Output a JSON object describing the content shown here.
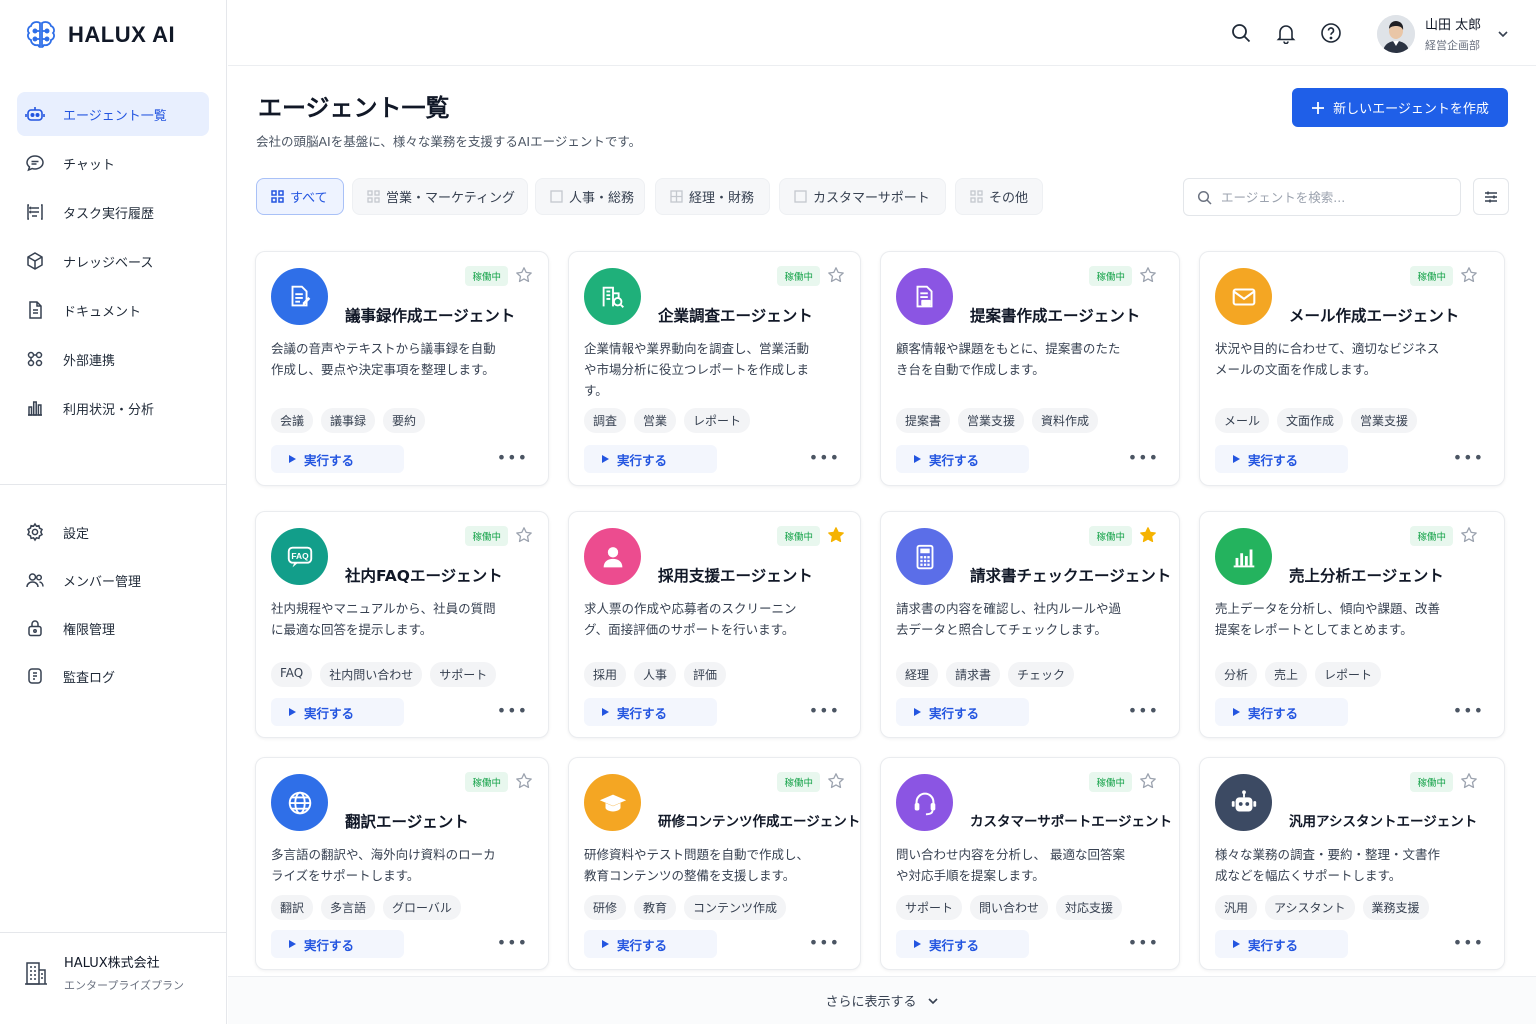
{
  "app": {
    "name": "HALUX AI"
  },
  "sidebar": {
    "items": [
      {
        "label": "エージェント一覧",
        "icon": "robot-icon",
        "active": true
      },
      {
        "label": "チャット",
        "icon": "chat-icon"
      },
      {
        "label": "タスク実行履歴",
        "icon": "task-history-icon"
      },
      {
        "label": "ナレッジベース",
        "icon": "cube-icon"
      },
      {
        "label": "ドキュメント",
        "icon": "document-icon"
      },
      {
        "label": "外部連携",
        "icon": "integration-icon"
      },
      {
        "label": "利用状況・分析",
        "icon": "analytics-icon"
      }
    ],
    "admin_items": [
      {
        "label": "設定",
        "icon": "gear-icon"
      },
      {
        "label": "メンバー管理",
        "icon": "users-icon"
      },
      {
        "label": "権限管理",
        "icon": "lock-icon"
      },
      {
        "label": "監査ログ",
        "icon": "audit-log-icon"
      }
    ],
    "org": {
      "name": "HALUX株式会社",
      "plan": "エンタープライズプラン"
    }
  },
  "header": {
    "user": {
      "name": "山田 太郎",
      "department": "経営企画部"
    }
  },
  "main": {
    "title": "エージェント一覧",
    "subtitle": "会社の頭脳AIを基盤に、様々な業務を支援するAIエージェントです。",
    "new_button": "新しいエージェントを作成",
    "tabs": [
      {
        "label": "すべて",
        "active": true
      },
      {
        "label": "営業・マーケティング"
      },
      {
        "label": "人事・総務"
      },
      {
        "label": "経理・財務"
      },
      {
        "label": "カスタマーサポート"
      },
      {
        "label": "その他"
      }
    ],
    "search_placeholder": "エージェントを検索...",
    "run_label": "実行する",
    "more_label": "•••",
    "show_more": "さらに表示する"
  },
  "agents": [
    {
      "title": "議事録作成エージェント",
      "status": "稼働中",
      "favorite": false,
      "icon": "minutes-doc-icon",
      "color": "#2f6fe8",
      "desc": "会議の音声やテキストから議事録を自動作成し、要点や決定事項を整理します。",
      "tags": [
        "会議",
        "議事録",
        "要約"
      ]
    },
    {
      "title": "企業調査エージェント",
      "status": "稼働中",
      "favorite": false,
      "icon": "building-search-icon",
      "color": "#1fb07a",
      "desc": "企業情報や業界動向を調査し、営業活動や市場分析に役立つレポートを作成します。",
      "tags": [
        "調査",
        "営業",
        "レポート"
      ]
    },
    {
      "title": "提案書作成エージェント",
      "status": "稼働中",
      "favorite": false,
      "icon": "proposal-doc-icon",
      "color": "#8b55e3",
      "desc": "顧客情報や課題をもとに、提案書のたたき台を自動で作成します。",
      "tags": [
        "提案書",
        "営業支援",
        "資料作成"
      ]
    },
    {
      "title": "メール作成エージェント",
      "status": "稼働中",
      "favorite": false,
      "icon": "mail-icon",
      "color": "#f4a623",
      "desc": "状況や目的に合わせて、適切なビジネスメールの文面を作成します。",
      "tags": [
        "メール",
        "文面作成",
        "営業支援"
      ]
    },
    {
      "title": "社内FAQエージェント",
      "status": "稼働中",
      "favorite": false,
      "icon": "faq-icon",
      "color": "#129e8a",
      "desc": "社内規程やマニュアルから、社員の質問に最適な回答を提示します。",
      "tags": [
        "FAQ",
        "社内問い合わせ",
        "サポート"
      ]
    },
    {
      "title": "採用支援エージェント",
      "status": "稼働中",
      "favorite": true,
      "icon": "person-icon",
      "color": "#ec4c8f",
      "desc": "求人票の作成や応募者のスクリーニング、面接評価のサポートを行います。",
      "tags": [
        "採用",
        "人事",
        "評価"
      ]
    },
    {
      "title": "請求書チェックエージェント",
      "status": "稼働中",
      "favorite": true,
      "icon": "calculator-icon",
      "color": "#5b6ee8",
      "desc": "請求書の内容を確認し、社内ルールや過去データと照合してチェックします。",
      "tags": [
        "経理",
        "請求書",
        "チェック"
      ]
    },
    {
      "title": "売上分析エージェント",
      "status": "稼働中",
      "favorite": false,
      "icon": "bar-chart-icon",
      "color": "#24b35e",
      "desc": "売上データを分析し、傾向や課題、改善提案をレポートとしてまとめます。",
      "tags": [
        "分析",
        "売上",
        "レポート"
      ]
    },
    {
      "title": "翻訳エージェント",
      "status": "稼働中",
      "favorite": false,
      "icon": "globe-icon",
      "color": "#2f6fe8",
      "desc": "多言語の翻訳や、海外向け資料のローカライズをサポートします。",
      "tags": [
        "翻訳",
        "多言語",
        "グローバル"
      ]
    },
    {
      "title": "研修コンテンツ作成エージェント",
      "status": "稼働中",
      "favorite": false,
      "icon": "graduation-cap-icon",
      "color": "#f4a623",
      "desc": "研修資料やテスト問題を自動で作成し、教育コンテンツの整備を支援します。",
      "tags": [
        "研修",
        "教育",
        "コンテンツ作成"
      ]
    },
    {
      "title": "カスタマーサポートエージェント",
      "status": "稼働中",
      "favorite": false,
      "icon": "headset-icon",
      "color": "#8b55e3",
      "desc": "問い合わせ内容を分析し、 最適な回答案や対応手順を提案します。",
      "tags": [
        "サポート",
        "問い合わせ",
        "対応支援"
      ]
    },
    {
      "title": "汎用アシスタントエージェント",
      "status": "稼働中",
      "favorite": false,
      "icon": "robot-icon",
      "color": "#3c4a63",
      "desc": "様々な業務の調査・要約・整理・文書作成などを幅広くサポートします。",
      "tags": [
        "汎用",
        "アシスタント",
        "業務支援"
      ]
    }
  ]
}
